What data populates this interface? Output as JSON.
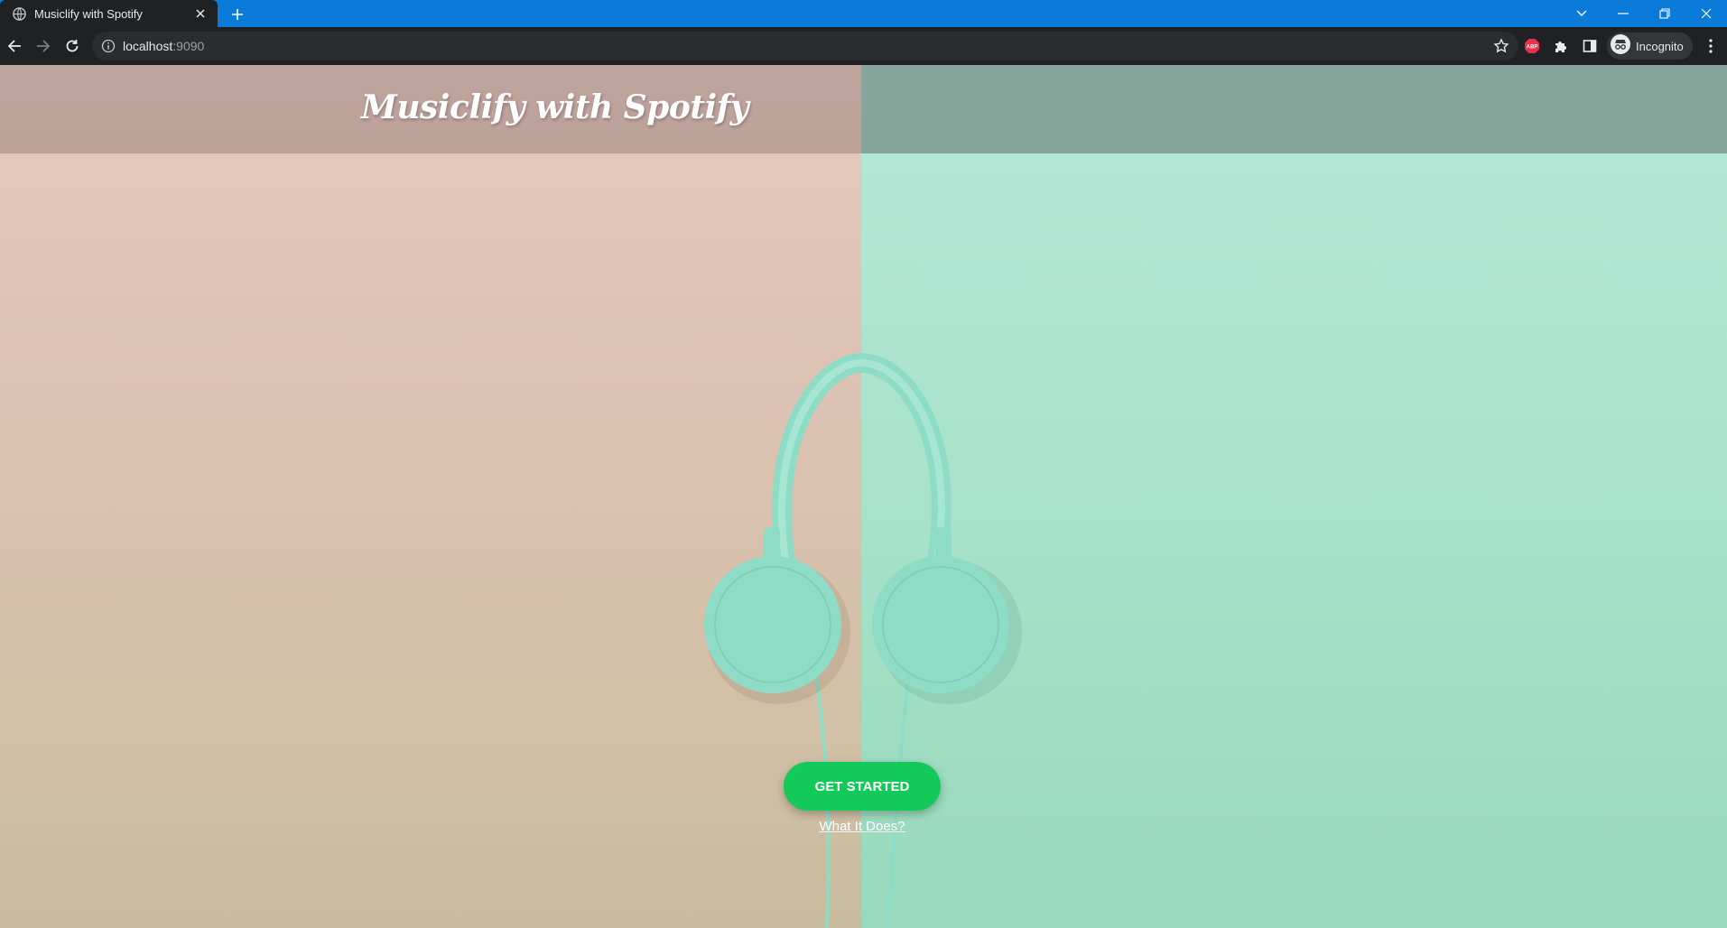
{
  "browser": {
    "tab_title": "Musiclify with Spotify",
    "url_host": "localhost",
    "url_port": ":9090",
    "profile_label": "Incognito",
    "extensions": [
      "adblock-icon",
      "puzzle-icon",
      "side-panel-icon"
    ]
  },
  "page": {
    "site_title": "Musiclify with Spotify",
    "cta_label": "GET STARTED",
    "secondary_link": "What It Does?",
    "colors": {
      "left_bg": "#dcc2b2",
      "right_bg": "#a9e3cc",
      "headphone_color": "#8fdcc6",
      "button_green": "#13c95a"
    }
  }
}
